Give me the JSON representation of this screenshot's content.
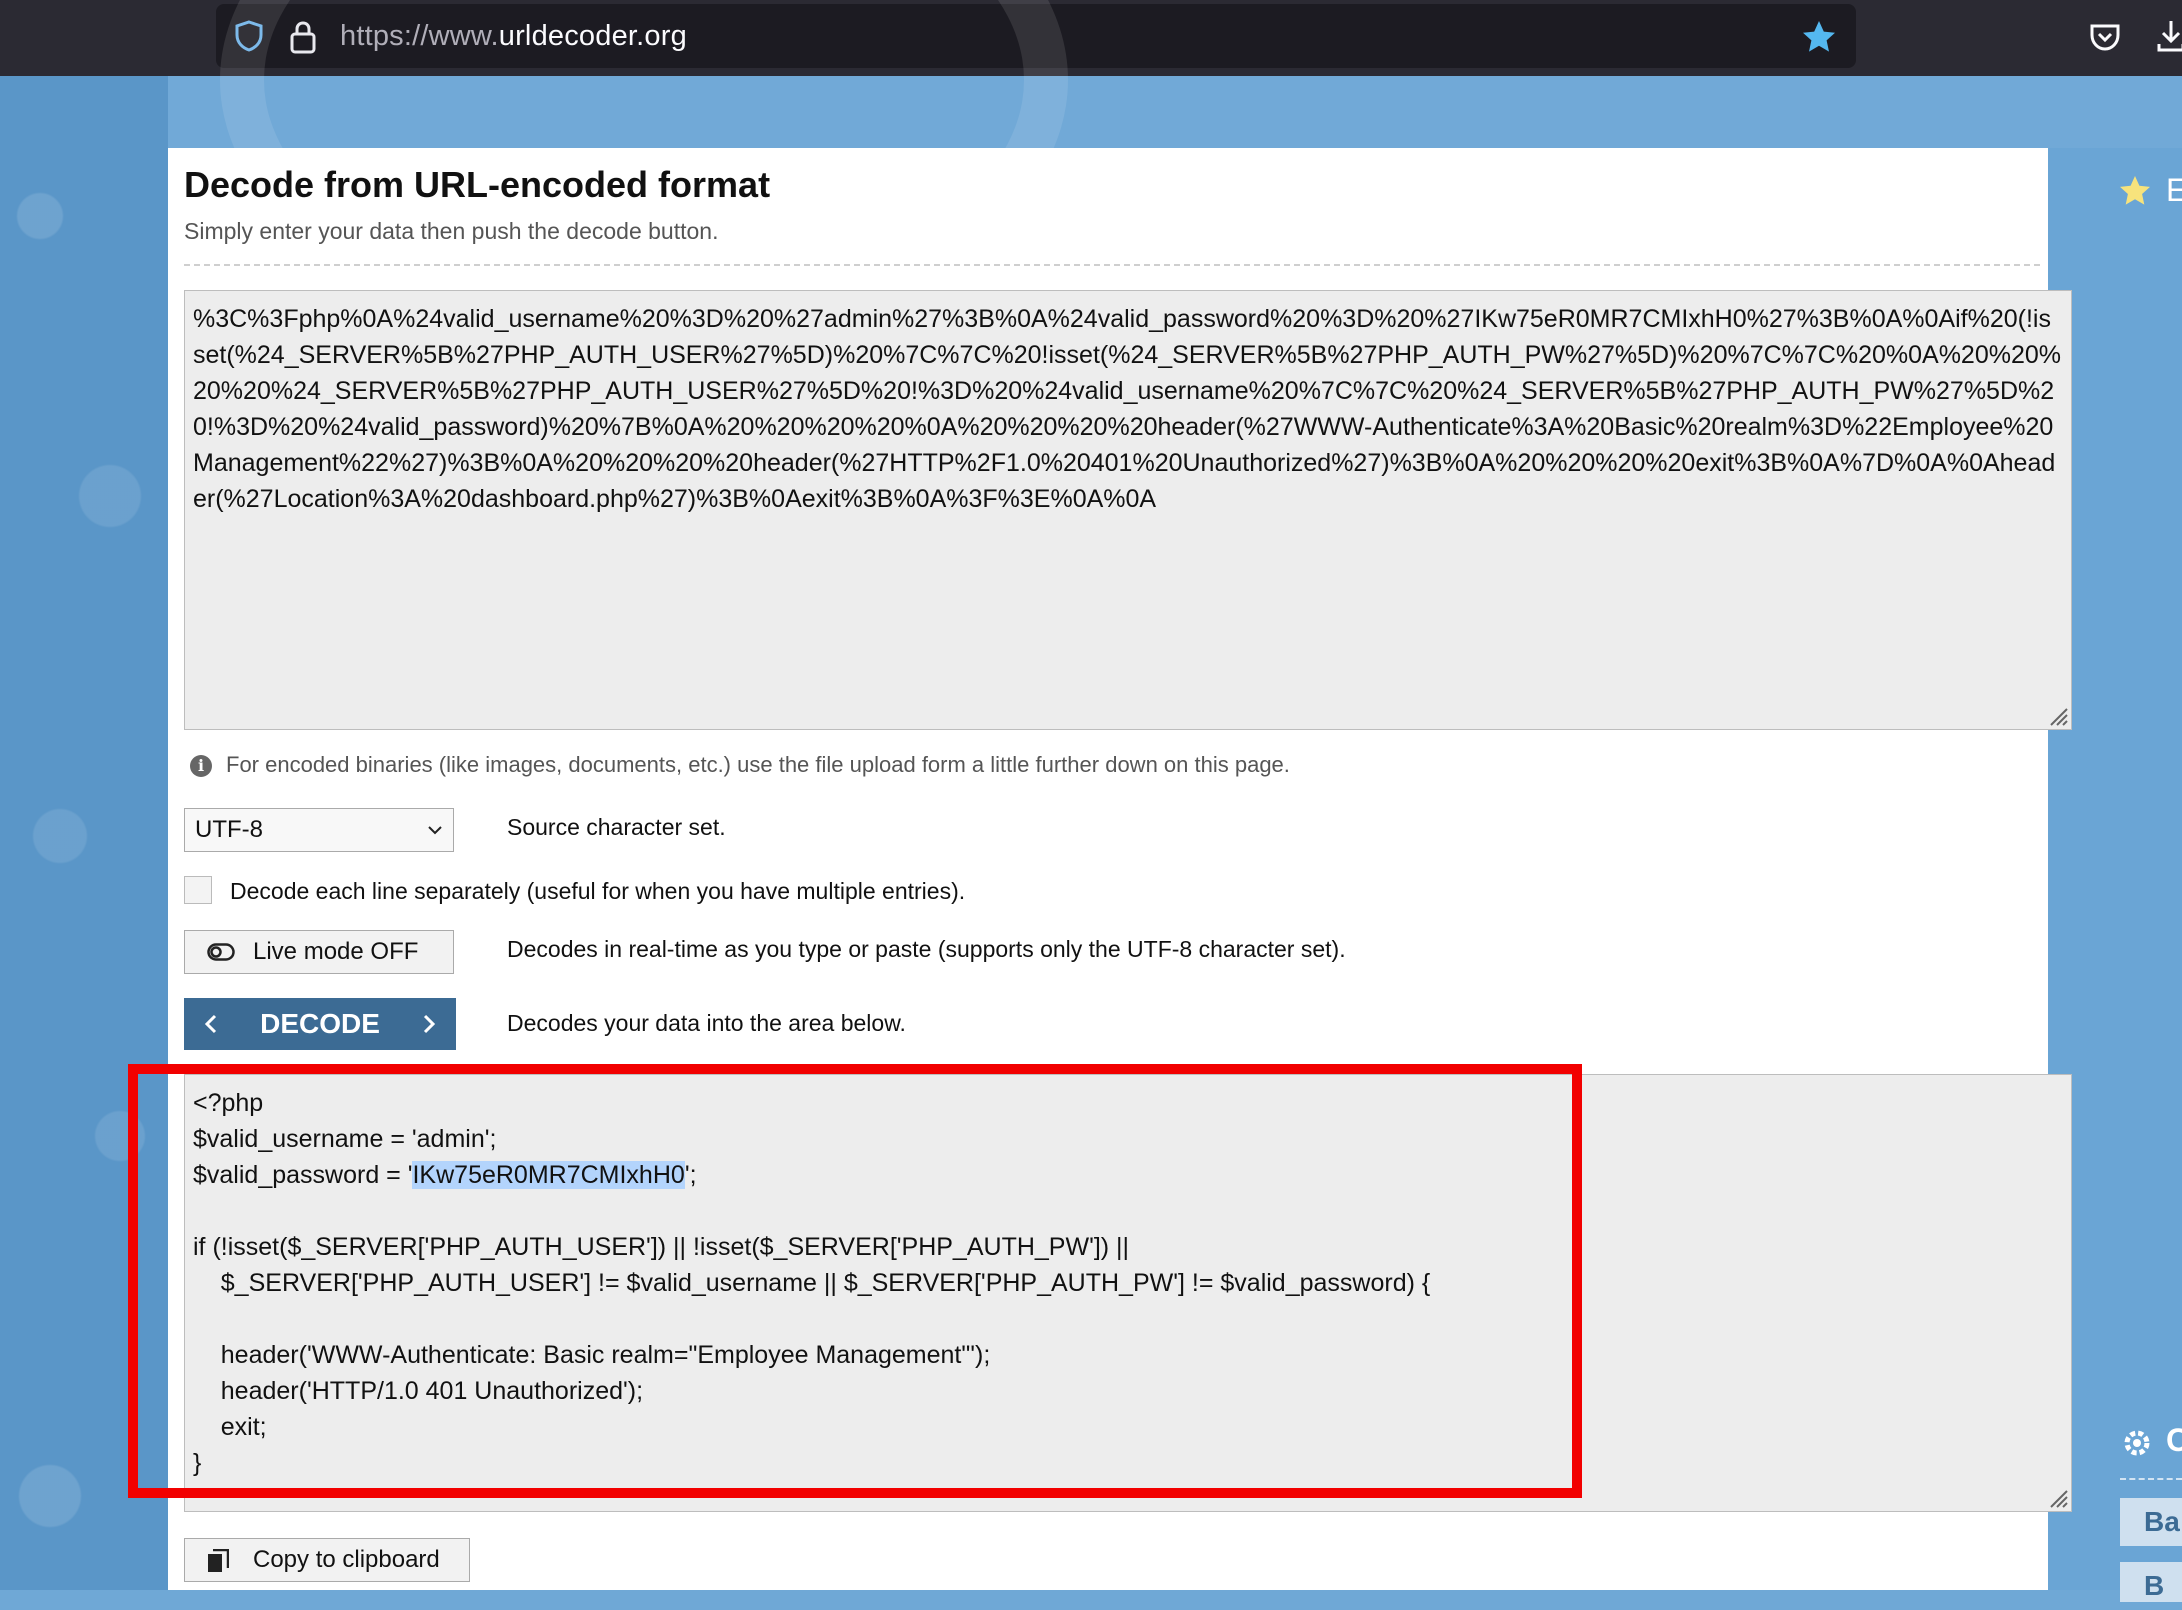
{
  "browser": {
    "url_scheme": "https://www.",
    "url_host": "urldecoder.org",
    "icons": [
      "shield-icon",
      "lock-icon",
      "bookmark-star-icon",
      "pocket-icon",
      "download-icon"
    ]
  },
  "main": {
    "title": "Decode from URL-encoded format",
    "subtitle": "Simply enter your data then push the decode button.",
    "input_text": "%3C%3Fphp%0A%24valid_username%20%3D%20%27admin%27%3B%0A%24valid_password%20%3D%20%27IKw75eR0MR7CMIxhH0%27%3B%0A%0Aif%20(!isset(%24_SERVER%5B%27PHP_AUTH_USER%27%5D)%20%7C%7C%20!isset(%24_SERVER%5B%27PHP_AUTH_PW%27%5D)%20%7C%7C%20%0A%20%20%20%20%24_SERVER%5B%27PHP_AUTH_USER%27%5D%20!%3D%20%24valid_username%20%7C%7C%20%24_SERVER%5B%27PHP_AUTH_PW%27%5D%20!%3D%20%24valid_password)%20%7B%0A%20%20%20%20%0A%20%20%20%20header(%27WWW-Authenticate%3A%20Basic%20realm%3D%22Employee%20Management%22%27)%3B%0A%20%20%20%20header(%27HTTP%2F1.0%20401%20Unauthorized%27)%3B%0A%20%20%20%20exit%3B%0A%7D%0A%0Aheader(%27Location%3A%20dashboard.php%27)%3B%0Aexit%3B%0A%3F%3E%0A%0A",
    "info_text": "For encoded binaries (like images, documents, etc.) use the file upload form a little further down on this page.",
    "charset": {
      "selected": "UTF-8",
      "label": "Source character set."
    },
    "per_line_label": "Decode each line separately (useful for when you have multiple entries).",
    "live_mode": {
      "button_label": "Live mode OFF",
      "description": "Decodes in real-time as you type or paste (supports only the UTF-8 character set)."
    },
    "decode": {
      "button_label": "DECODE",
      "description": "Decodes your data into the area below."
    },
    "output": {
      "line1": "<?php",
      "line2": "$valid_username = 'admin';",
      "line3_prefix": "$valid_password = '",
      "line3_highlight": "IKw75eR0MR7CMIxhH0",
      "line3_suffix": "';",
      "line4": "",
      "line5": "if (!isset($_SERVER['PHP_AUTH_USER']) || !isset($_SERVER['PHP_AUTH_PW']) ||",
      "line6": "    $_SERVER['PHP_AUTH_USER'] != $valid_username || $_SERVER['PHP_AUTH_PW'] != $valid_password) {",
      "line7": "",
      "line8": "    header('WWW-Authenticate: Basic realm=\"Employee Management\"');",
      "line9": "    header('HTTP/1.0 401 Unauthorized');",
      "line10": "    exit;",
      "line11": "}"
    },
    "copy_label": "Copy to clipboard"
  },
  "sidebar": {
    "top_letter": "E",
    "gear_letter": "C",
    "button1": "Ba",
    "button2": "B"
  },
  "colors": {
    "annotation_box": "#f20000",
    "decode_button": "#3c6b94",
    "page_background": "#6fa8d6"
  }
}
